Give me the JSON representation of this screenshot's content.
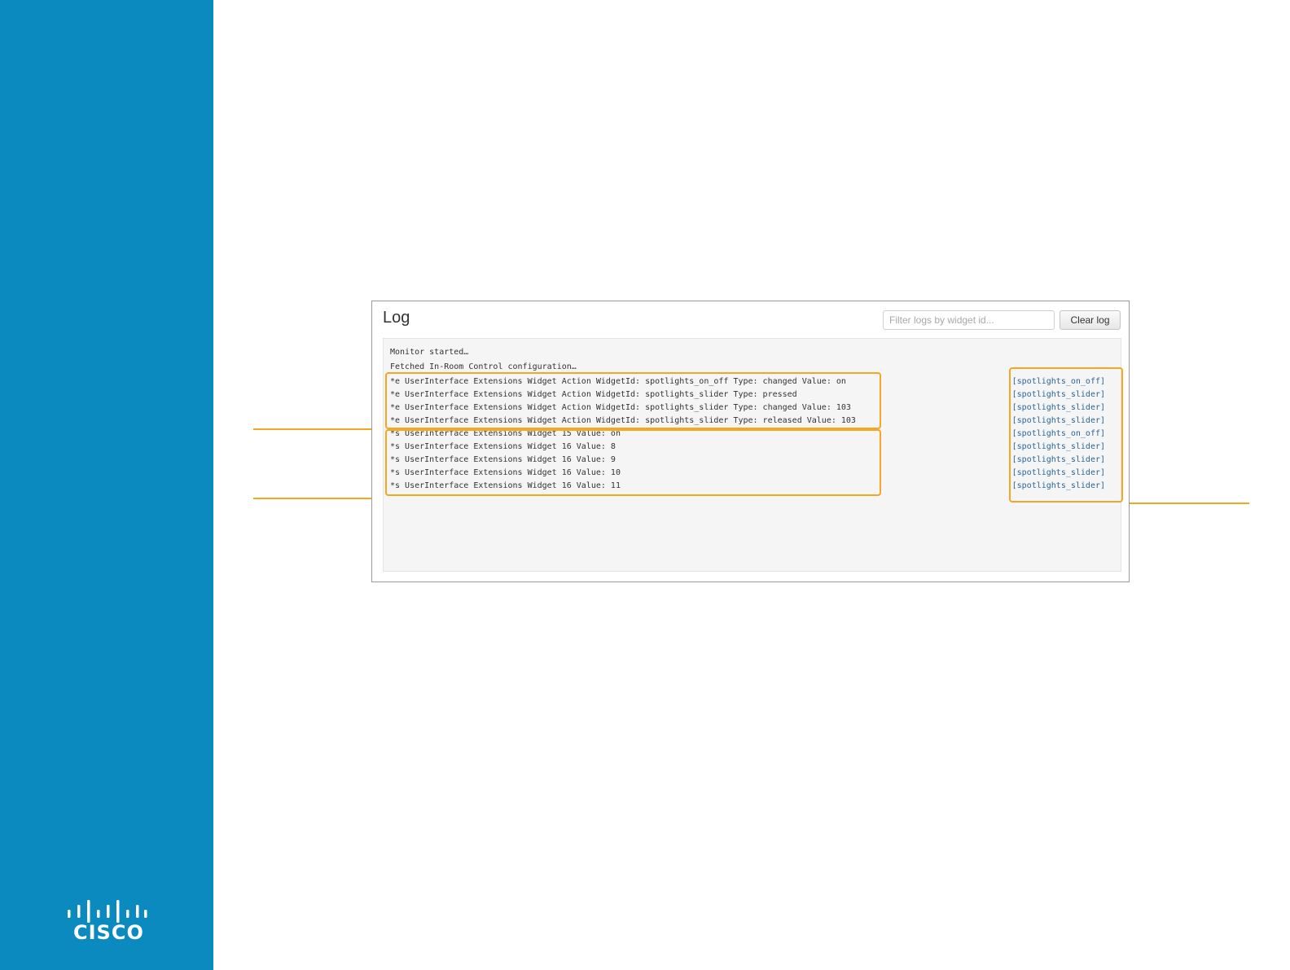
{
  "brand": {
    "logo_text": "CISCO",
    "sidebar_color": "#0a8abf",
    "highlight_color": "#f5a623"
  },
  "log_panel": {
    "title": "Log",
    "filter": {
      "placeholder": "Filter logs by widget id...",
      "value": ""
    },
    "clear_button_label": "Clear log",
    "lines": [
      "Monitor started…",
      "Fetched In-Room Control configuration…",
      "*e UserInterface Extensions Widget Action WidgetId: spotlights_on_off Type: changed Value: on",
      "*e UserInterface Extensions Widget Action WidgetId: spotlights_slider Type: pressed",
      "*e UserInterface Extensions Widget Action WidgetId: spotlights_slider Type: changed Value: 103",
      "*e UserInterface Extensions Widget Action WidgetId: spotlights_slider Type: released Value: 103",
      "*s UserInterface Extensions Widget 15 Value: on",
      "*s UserInterface Extensions Widget 16 Value: 8",
      "*s UserInterface Extensions Widget 16 Value: 9",
      "*s UserInterface Extensions Widget 16 Value: 10",
      "*s UserInterface Extensions Widget 16 Value: 11"
    ],
    "widget_ids": [
      "[spotlights_on_off]",
      "[spotlights_slider]",
      "[spotlights_slider]",
      "[spotlights_slider]",
      "[spotlights_on_off]",
      "[spotlights_slider]",
      "[spotlights_slider]",
      "[spotlights_slider]",
      "[spotlights_slider]"
    ]
  }
}
